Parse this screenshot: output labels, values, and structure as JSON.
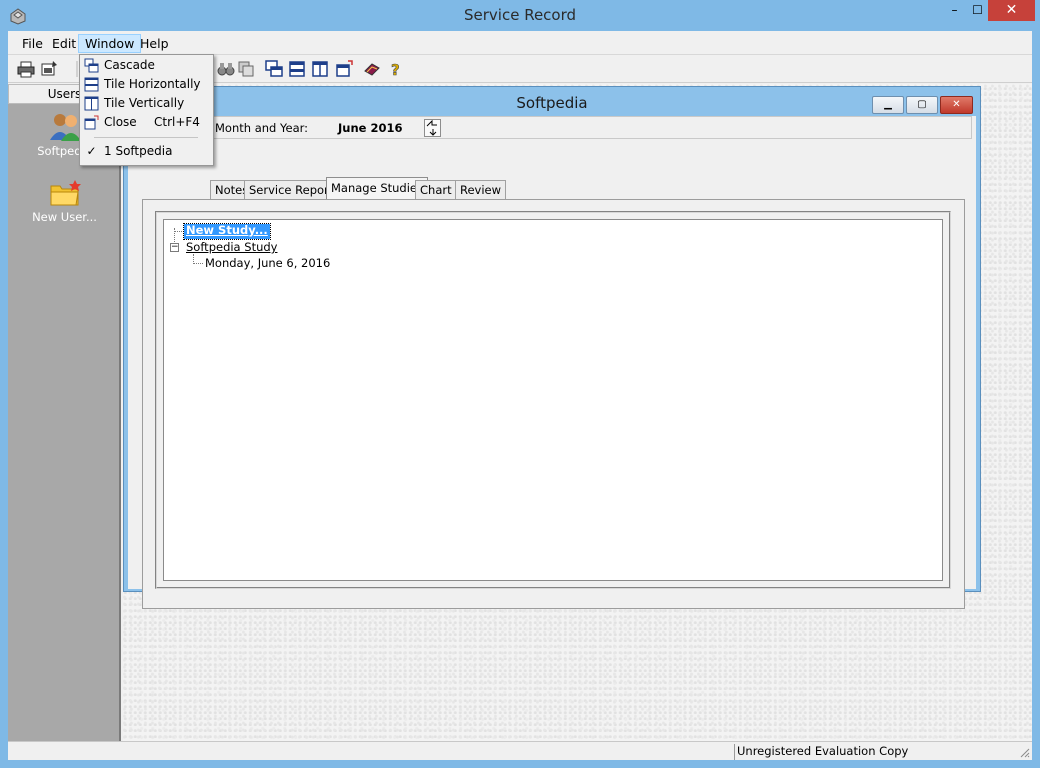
{
  "window": {
    "title": "Service Record",
    "controls": {
      "minimize": "–",
      "maximize": "☐",
      "close": "✕"
    }
  },
  "menubar": {
    "file": "File",
    "edit": "Edit",
    "window": "Window",
    "help": "Help"
  },
  "window_menu": {
    "items": [
      {
        "label": "Cascade",
        "icon": "cascade-icon"
      },
      {
        "label": "Tile Horizontally",
        "icon": "tile-horizontal-icon"
      },
      {
        "label": "Tile Vertically",
        "icon": "tile-vertical-icon"
      },
      {
        "label": "Close",
        "shortcut": "Ctrl+F4",
        "icon": "close-window-icon"
      },
      {
        "label": "1 Softpedia",
        "checked": true,
        "check": "✓"
      }
    ]
  },
  "toolbar": {
    "icons": [
      "print-icon",
      "print-setup-icon",
      "binoculars-icon",
      "copy-icon",
      "cascade-icon",
      "tile-horizontal-icon",
      "tile-vertical-icon",
      "close-window-icon",
      "book-icon",
      "help-icon"
    ]
  },
  "users_pane": {
    "header": "Users",
    "users": [
      {
        "label": "Softpedia",
        "icon": "users-icon"
      },
      {
        "label": "New User...",
        "icon": "new-folder-icon"
      }
    ]
  },
  "child_window": {
    "title": "Softpedia",
    "month_label": "Month and Year:",
    "month_value": "June 2016",
    "tabs": [
      "Notes",
      "Service Report",
      "Manage Studies",
      "Chart",
      "Review"
    ],
    "active_tab": "Manage Studies",
    "tree": {
      "new_study": "New Study...",
      "study": "Softpedia Study",
      "date": "Monday, June 6, 2016"
    }
  },
  "statusbar": {
    "text": "Unregistered Evaluation Copy"
  },
  "colors": {
    "title_bar": "#7fb9e6",
    "close_button": "#c6413a",
    "selection": "#3399ff",
    "users_pane": "#a8a8a8"
  }
}
